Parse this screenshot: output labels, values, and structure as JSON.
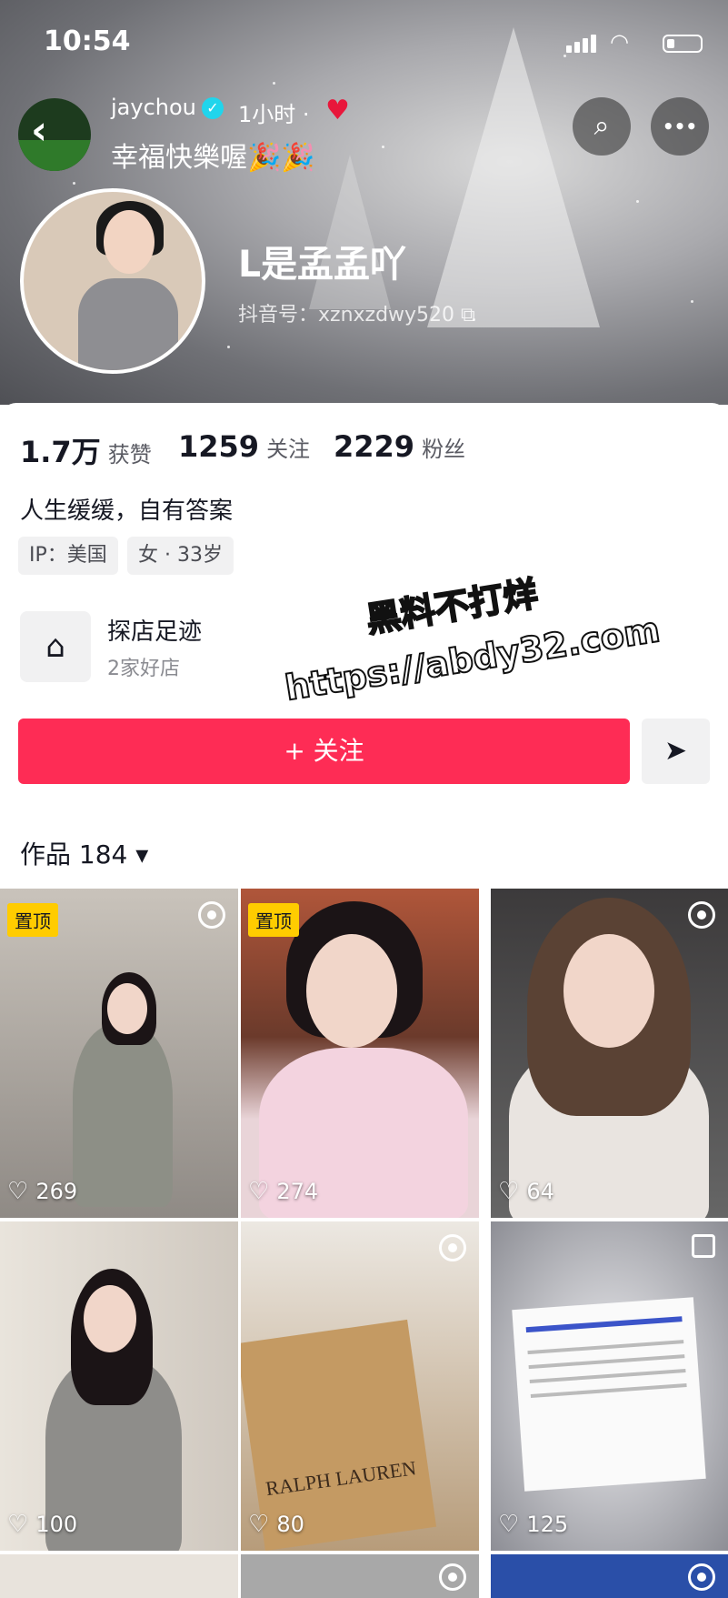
{
  "status_bar": {
    "time": "10:54"
  },
  "post_header": {
    "username": "jaychou",
    "verified_mark": "✓",
    "time": "1小时 ·",
    "text": "幸福快樂喔🎉🎉"
  },
  "profile": {
    "nickname": "是孟孟吖",
    "nickname_prefix": "ᒪ",
    "douyin_id": "抖音号：xznxzdwy520 ⧉",
    "stats": [
      {
        "num": "1.7万",
        "label": "获赞"
      },
      {
        "num": "1259",
        "label": "关注"
      },
      {
        "num": "2229",
        "label": "粉丝"
      }
    ],
    "bio": "人生缓缓，自有答案",
    "tags": [
      "IP：美国",
      "女 · 33岁"
    ],
    "shop": {
      "title": "探店足迹",
      "subtitle": "2家好店"
    },
    "follow_label": "+ 关注",
    "works_label": "作品 184 ▾"
  },
  "watermark": {
    "line1": "黑料不打烊",
    "line2": "https://abdy32.com"
  },
  "grid": {
    "pin_label": "置顶",
    "heart": "♡",
    "tiles": [
      {
        "likes": "269"
      },
      {
        "likes": "274"
      },
      {
        "likes": "64"
      },
      {
        "likes": "100"
      },
      {
        "likes": "80"
      },
      {
        "likes": "125"
      }
    ],
    "bag_text": "RALPH LAUREN"
  },
  "icons": {
    "back": "‹",
    "search": "⌕",
    "more": "•••",
    "heart_filled": "♥",
    "shop": "⌂",
    "share": "➤"
  },
  "colors": {
    "accent": "#fe2c55",
    "pin": "#ffcc00",
    "verified": "#20d5ec"
  }
}
